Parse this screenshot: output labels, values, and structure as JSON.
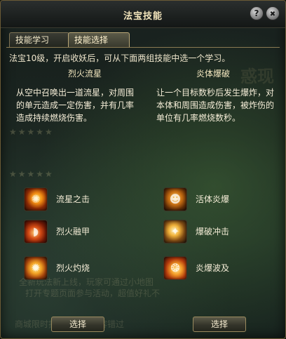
{
  "window": {
    "title": "法宝技能",
    "help_icon": "?",
    "close_icon": "✖"
  },
  "tabs": [
    {
      "label": "技能学习",
      "active": false
    },
    {
      "label": "技能选择",
      "active": true
    }
  ],
  "intro": "法宝10级，开启收妖后，可从下面两组技能中选一个学习。",
  "left": {
    "title": "烈火流星",
    "description": "从空中召唤出一道流星，对周围的单元造成一定伤害，并有几率造成持续燃烧伤害。",
    "skills": [
      {
        "name": "流星之击",
        "icon": "meteor-icon"
      },
      {
        "name": "烈火融甲",
        "icon": "fire-armor-icon"
      },
      {
        "name": "烈火灼烧",
        "icon": "burn-icon"
      }
    ],
    "select_label": "选择"
  },
  "right": {
    "title": "炎体爆破",
    "description": "让一个目标数秒后发生爆炸，对本体和周围造成伤害，被炸伤的单位有几率燃烧数秒。",
    "skills": [
      {
        "name": "活体炎爆",
        "icon": "living-blast-icon"
      },
      {
        "name": "爆破冲击",
        "icon": "blast-impact-icon"
      },
      {
        "name": "炎爆波及",
        "icon": "blast-wave-icon"
      }
    ],
    "select_label": "选择"
  },
  "background_text": {
    "stars": "★★★★★",
    "line1": "全新玩法新上线，玩家可通过小地图",
    "line2": "打开专题页面参与活动，超值好礼不",
    "line3": "商城限时折扣，机会不容错过"
  },
  "colors": {
    "accent": "#f4e6bd",
    "border": "#8a7a52",
    "button_border": "#9a8a5e"
  }
}
